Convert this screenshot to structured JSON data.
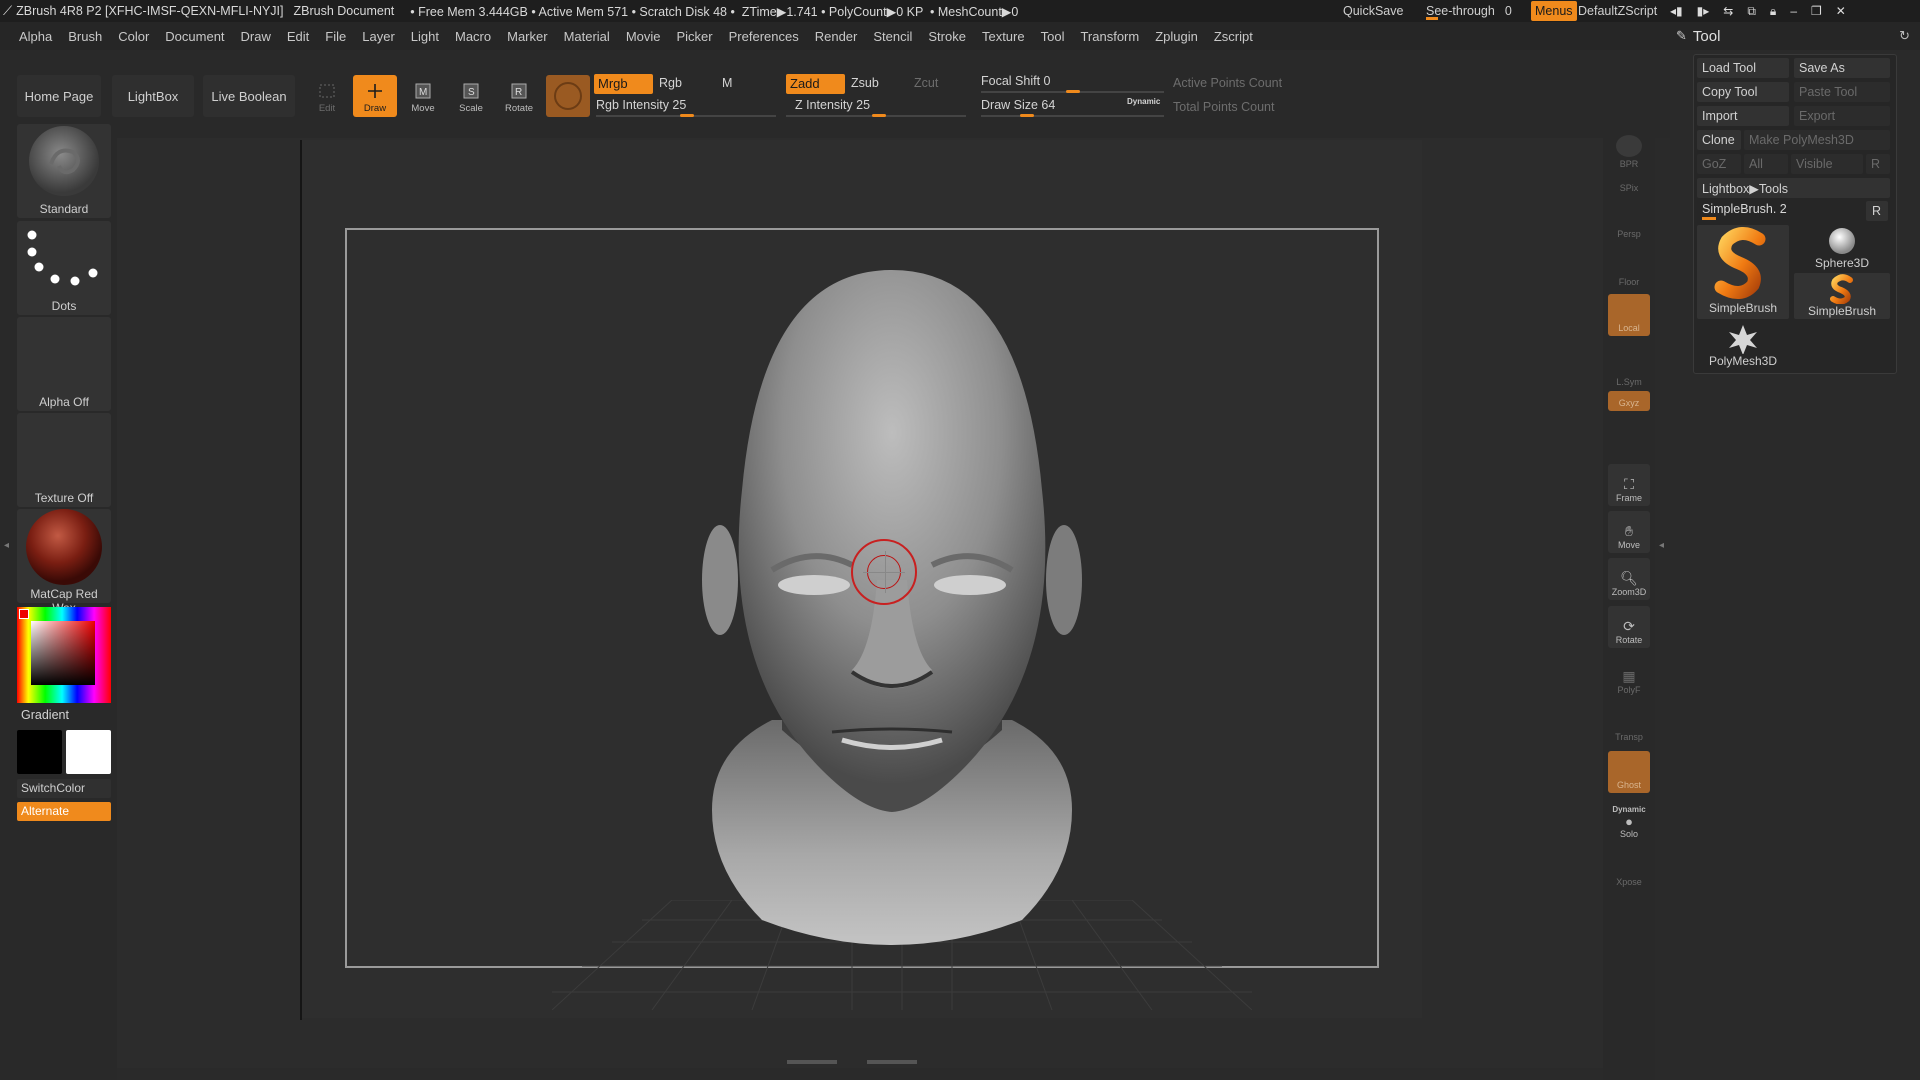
{
  "titlebar": {
    "app": "ZBrush 4R8 P2 [XFHC-IMSF-QEXN-MFLI-NYJI]",
    "document": "ZBrush Document",
    "stats": "• Free Mem 3.444GB • Active Mem 571 • Scratch Disk 48 •  ZTime▶1.741 • PolyCount▶0 KP  • MeshCount▶0",
    "quicksave": "QuickSave",
    "see_through": "See-through",
    "see_through_value": "0",
    "menus": "Menus",
    "default_zscript": "DefaultZScript"
  },
  "menubar": [
    "Alpha",
    "Brush",
    "Color",
    "Document",
    "Draw",
    "Edit",
    "File",
    "Layer",
    "Light",
    "Macro",
    "Marker",
    "Material",
    "Movie",
    "Picker",
    "Preferences",
    "Render",
    "Stencil",
    "Stroke",
    "Texture",
    "Tool",
    "Transform",
    "Zplugin",
    "Zscript"
  ],
  "toolbar": {
    "home_page": "Home Page",
    "lightbox": "LightBox",
    "live_boolean": "Live Boolean",
    "edit": "Edit",
    "draw": "Draw",
    "move": "Move",
    "scale": "Scale",
    "rotate": "Rotate",
    "mrgb": "Mrgb",
    "rgb": "Rgb",
    "m": "M",
    "zadd": "Zadd",
    "zsub": "Zsub",
    "zcut": "Zcut",
    "rgb_intensity": "Rgb Intensity 25",
    "z_intensity": "Z Intensity 25",
    "focal_shift": "Focal Shift 0",
    "draw_size": "Draw Size 64",
    "dynamic": "Dynamic",
    "active_points": "Active Points Count",
    "total_points": "Total Points Count",
    "rgb_intensity_pct": 0.25,
    "z_intensity_pct": 0.25,
    "draw_size_pct": 0.16
  },
  "left_shelf": {
    "standard": "Standard",
    "dots": "Dots",
    "alpha_off": "Alpha Off",
    "texture_off": "Texture Off",
    "matcap": "MatCap Red Wax",
    "gradient": "Gradient",
    "switchcolor": "SwitchColor",
    "alternate": "Alternate"
  },
  "right_shelf": {
    "bpr": "BPR",
    "spix": "SPix",
    "persp": "Persp",
    "floor": "Floor",
    "local": "Local",
    "lsym": "L.Sym",
    "xyz": "Gxyz",
    "frame": "Frame",
    "move": "Move",
    "zoom3d": "Zoom3D",
    "rotate": "Rotate",
    "polyf": "PolyF",
    "transp": "Transp",
    "ghost": "Ghost",
    "dynamic": "Dynamic",
    "solo": "Solo",
    "xpose": "Xpose"
  },
  "tool_panel": {
    "title": "Tool",
    "load_tool": "Load Tool",
    "save_as": "Save As",
    "copy_tool": "Copy Tool",
    "paste_tool": "Paste Tool",
    "import": "Import",
    "export": "Export",
    "clone": "Clone",
    "make_polymesh": "Make PolyMesh3D",
    "goz": "GoZ",
    "all": "All",
    "visible": "Visible",
    "r": "R",
    "lightbox_tools": "Lightbox▶Tools",
    "current_tool": "SimpleBrush. 2",
    "tools": [
      "SimpleBrush",
      "Sphere3D",
      "SimpleBrush",
      "PolyMesh3D"
    ]
  }
}
